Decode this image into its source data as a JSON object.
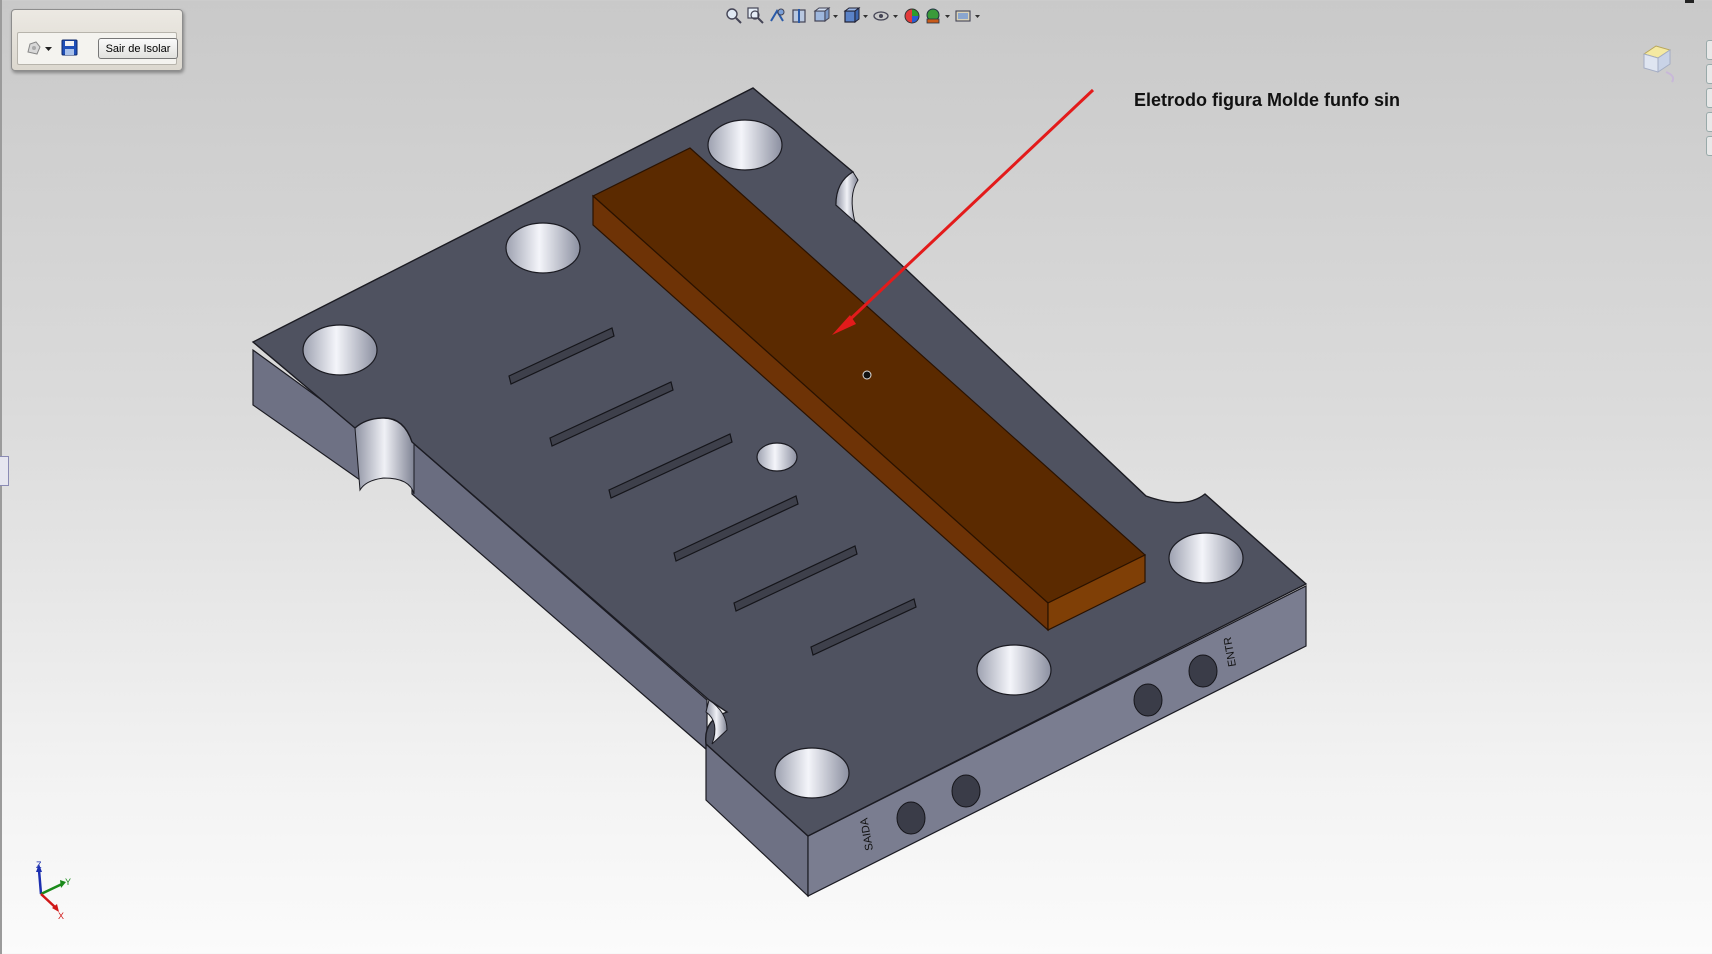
{
  "isolate_toolbar": {
    "exit_label": "Sair de Isolar",
    "icons": [
      "display-style-icon",
      "dropdown-arrow-icon",
      "save-icon"
    ]
  },
  "hud_toolbar": {
    "icons": [
      "zoom-to-fit-icon",
      "zoom-to-area-icon",
      "previous-view-icon",
      "section-view-icon",
      "view-orientation-icon",
      "display-style-icon",
      "hide-show-items-icon",
      "edit-appearance-icon",
      "apply-scene-icon",
      "view-settings-icon"
    ]
  },
  "annotation": {
    "text": "Eletrodo figura Molde funfo sin",
    "arrow_color": "#e31b1b"
  },
  "model": {
    "plate_color": "#4f5260",
    "side_color": "#6e7184",
    "electrode_color": "#5b2a00",
    "electrode_edge_color": "#7f3f06",
    "engraving_right": "ENTR",
    "engraving_left": "SAIDA"
  },
  "triad": {
    "axis_x": "X",
    "axis_y": "Y",
    "axis_z": "Z",
    "colors": {
      "x": "#d01818",
      "y": "#1a8a1a",
      "z": "#1c2fb0"
    }
  }
}
